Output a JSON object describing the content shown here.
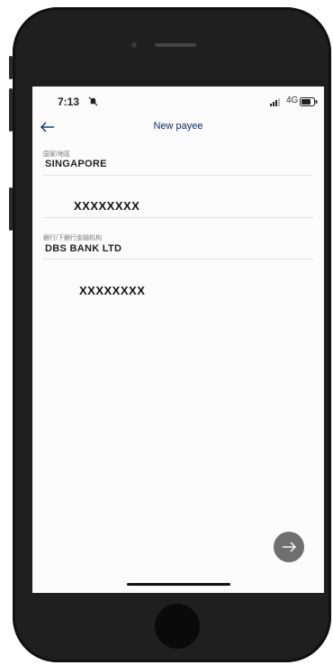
{
  "status_bar": {
    "time": "7:13",
    "network": "4G"
  },
  "header": {
    "title": "New payee",
    "back_icon": "arrow-left-icon"
  },
  "fields": {
    "country_label": "国家/地區",
    "country_value": "SINGAPORE",
    "account_masked": "XXXXXXXX",
    "bank_label": "銀行/下銀行金融机构",
    "bank_value": "DBS BANK LTD",
    "second_masked": "XXXXXXXX"
  },
  "actions": {
    "next_icon": "arrow-right-icon"
  },
  "colors": {
    "title": "#0d2a6e",
    "fab": "#6f6f6f",
    "phone_frame": "#1f1f1f"
  }
}
